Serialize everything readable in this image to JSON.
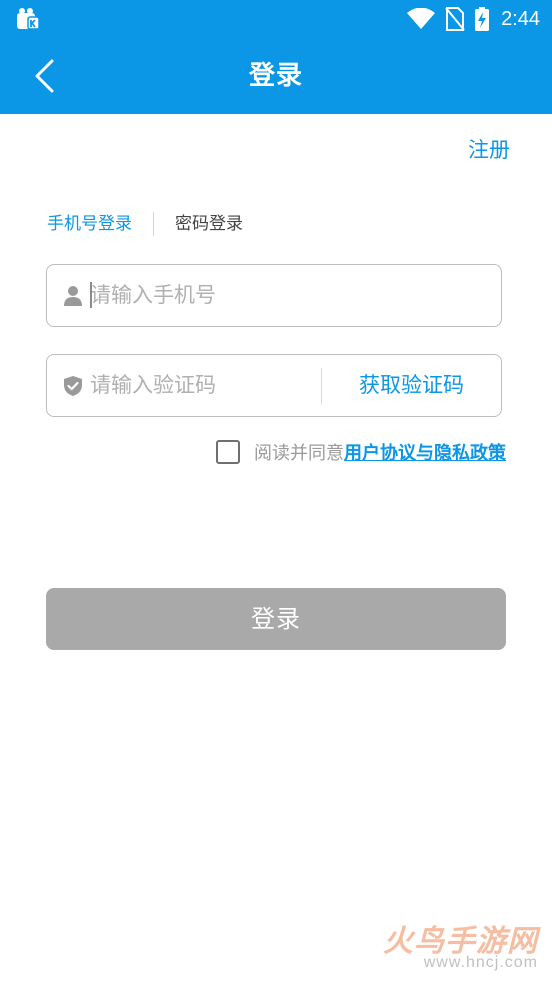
{
  "status_bar": {
    "time": "2:44",
    "icons": [
      "app-notification-icon",
      "wifi-icon",
      "no-sim-icon",
      "battery-charging-icon"
    ]
  },
  "app_bar": {
    "title": "登录",
    "back_icon": "chevron-left-icon"
  },
  "register_label": "注册",
  "tabs": [
    {
      "label": "手机号登录",
      "active": true
    },
    {
      "label": "密码登录",
      "active": false
    }
  ],
  "phone_field": {
    "icon": "person-icon",
    "placeholder": "请输入手机号",
    "value": ""
  },
  "code_field": {
    "icon": "shield-check-icon",
    "placeholder": "请输入验证码",
    "value": "",
    "button_label": "获取验证码"
  },
  "agreement": {
    "checked": false,
    "text": "阅读并同意",
    "link_text": "用户协议与隐私政策"
  },
  "login_button_label": "登录",
  "watermark": {
    "main": "火鸟手游网",
    "sub": "www.hncj.com"
  },
  "colors": {
    "primary": "#0b96e6",
    "disabled_button": "#a9a9a9",
    "placeholder": "#b0b0b0"
  }
}
